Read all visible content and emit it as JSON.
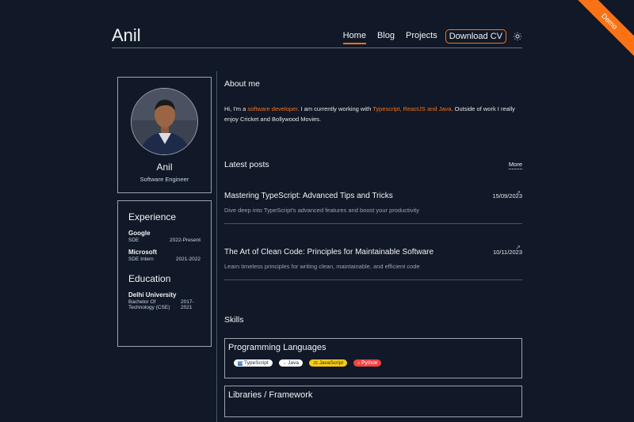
{
  "ribbon": "Demo",
  "header": {
    "brand": "Anil",
    "nav": {
      "home": "Home",
      "blog": "Blog",
      "projects": "Projects",
      "cv": "Download CV"
    }
  },
  "profile": {
    "name": "Anil",
    "role": "Software Engineer"
  },
  "experience": {
    "heading": "Experience",
    "items": [
      {
        "org": "Google",
        "role": "SDE",
        "period": "2022-Present"
      },
      {
        "org": "Microsoft",
        "role": "SDE Intern",
        "period": "2021-2022"
      }
    ]
  },
  "education": {
    "heading": "Education",
    "items": [
      {
        "org": "Delhi University",
        "degree": "Bachelor Of Technology (CSE)",
        "period": "2017-2021"
      }
    ]
  },
  "about": {
    "title": "About me",
    "p1": "Hi, I'm a ",
    "highlight1": "software developer",
    "p2": ". I am currently working with ",
    "highlight2": "Typescript, ReactJS and Java",
    "p3": ". Outside of work I really enjoy Cricket and Bollywood Movies."
  },
  "posts": {
    "title": "Latest posts",
    "more": "More",
    "items": [
      {
        "title": "Mastering TypeScript: Advanced Tips and Tricks",
        "date": "15/09/2023",
        "description": "Dive deep into TypeScript's advanced features and boost your productivity"
      },
      {
        "title": "The Art of Clean Code: Principles for Maintainable Software",
        "date": "10/11/2023",
        "description": "Learn timeless principles for writing clean, maintainable, and efficient code"
      }
    ]
  },
  "skills": {
    "title": "Skills",
    "groups": [
      {
        "heading": "Programming Languages",
        "tags": [
          "TypeScript",
          "Java",
          "JavaScript",
          "Python"
        ]
      },
      {
        "heading": "Libraries / Framework"
      }
    ]
  },
  "colors": {
    "accent": "#f97316",
    "background": "#111827"
  },
  "icons": {
    "theme_toggle": "sun-icon",
    "post_link": "arrow-up-right-icon"
  }
}
